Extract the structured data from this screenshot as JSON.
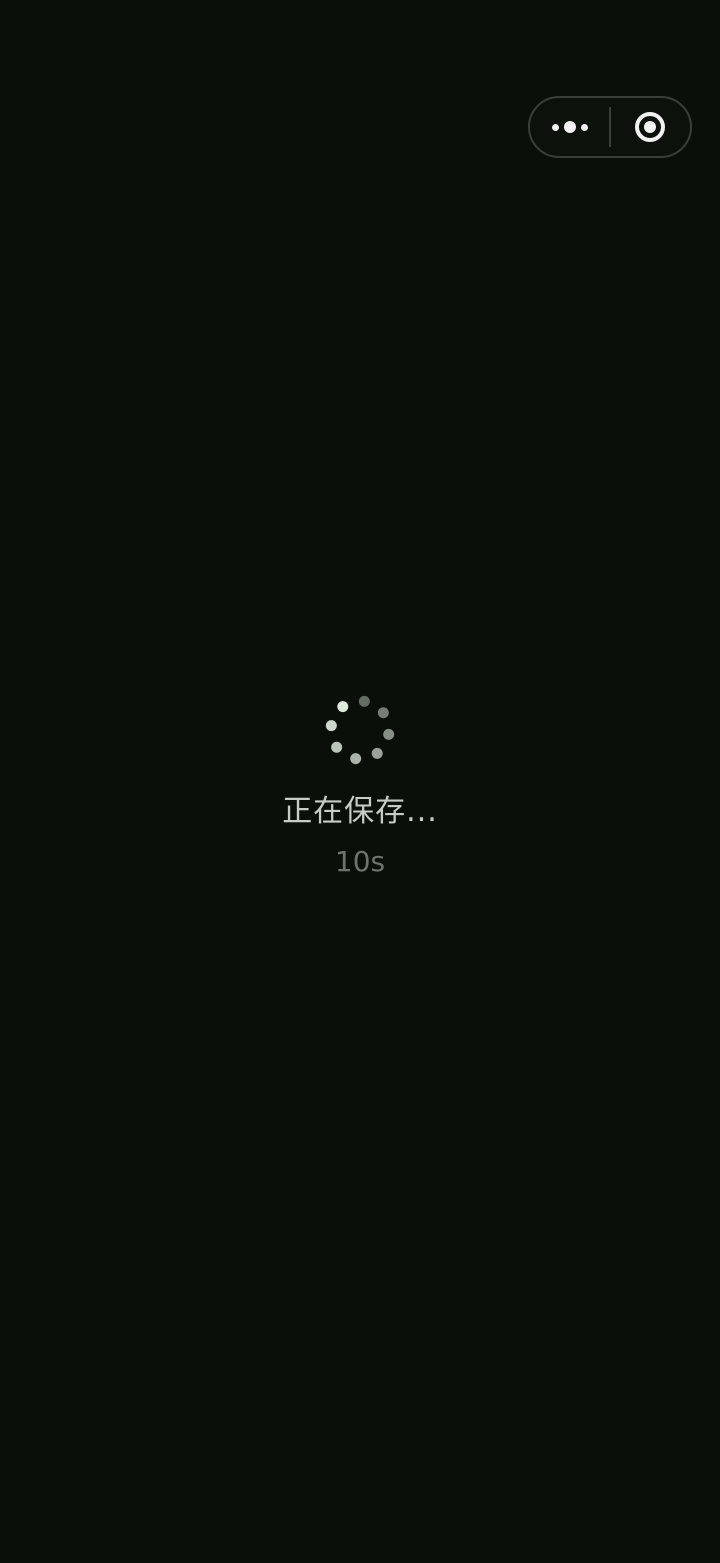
{
  "capsule": {
    "more_icon": "more-dots-icon",
    "close_icon": "close-circle-icon"
  },
  "loading": {
    "spinner_icon": "loading-spinner-icon",
    "text": "正在保存...",
    "timer": "10s"
  },
  "colors": {
    "background": "#0a0f0a",
    "capsule_border": "#3a3f3a",
    "text": "#c8ccc6",
    "timer": "#6e746c",
    "spinner_dot": "#dfe8dc"
  }
}
